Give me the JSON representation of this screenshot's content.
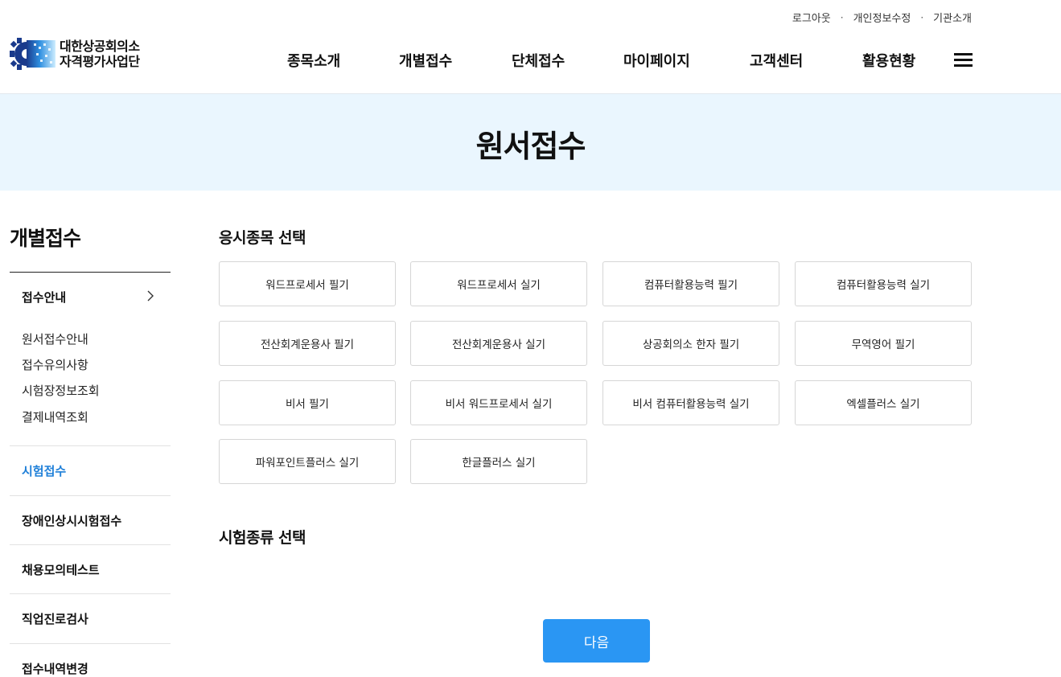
{
  "util_links": [
    {
      "label": "로그아웃"
    },
    {
      "label": "개인정보수정"
    },
    {
      "label": "기관소개"
    }
  ],
  "util_separator": "·",
  "logo": {
    "line1": "대한상공회의소",
    "line2": "자격평가사업단",
    "icon": "gear-logo-icon",
    "colors": [
      "#1a3a8c",
      "#2e8fe0",
      "#6fc3f7"
    ]
  },
  "nav": {
    "items": [
      {
        "label": "종목소개"
      },
      {
        "label": "개별접수"
      },
      {
        "label": "단체접수"
      },
      {
        "label": "마이페이지"
      },
      {
        "label": "고객센터"
      },
      {
        "label": "활용현황"
      }
    ],
    "menu_icon": "hamburger-menu-icon"
  },
  "hero": {
    "title": "원서접수",
    "background": "#eaf6fe"
  },
  "sidebar": {
    "title": "개별접수",
    "group": {
      "label": "접수안내",
      "icon": "chevron-right-icon"
    },
    "sub_items": [
      {
        "label": "원서접수안내"
      },
      {
        "label": "접수유의사항"
      },
      {
        "label": "시험장정보조회"
      },
      {
        "label": "결제내역조회"
      }
    ],
    "menu_items": [
      {
        "label": "시험접수",
        "active": true
      },
      {
        "label": "장애인상시시험접수",
        "active": false
      },
      {
        "label": "채용모의테스트",
        "active": false
      },
      {
        "label": "직업진로검사",
        "active": false
      },
      {
        "label": "접수내역변경",
        "active": false
      }
    ],
    "active_color": "#1e7fd8"
  },
  "main": {
    "subject_title": "응시종목 선택",
    "exam_options": [
      {
        "label": "워드프로세서 필기"
      },
      {
        "label": "워드프로세서 실기"
      },
      {
        "label": "컴퓨터활용능력 필기"
      },
      {
        "label": "컴퓨터활용능력 실기"
      },
      {
        "label": "전산회계운용사 필기"
      },
      {
        "label": "전산회계운용사 실기"
      },
      {
        "label": "상공회의소 한자 필기"
      },
      {
        "label": "무역영어 필기"
      },
      {
        "label": "비서 필기"
      },
      {
        "label": "비서 워드프로세서 실기"
      },
      {
        "label": "비서 컴퓨터활용능력 실기"
      },
      {
        "label": "엑셀플러스 실기"
      },
      {
        "label": "파워포인트플러스 실기"
      },
      {
        "label": "한글플러스 실기"
      }
    ],
    "type_title": "시험종류 선택",
    "next_label": "다음",
    "next_color": "#2a96f3"
  }
}
